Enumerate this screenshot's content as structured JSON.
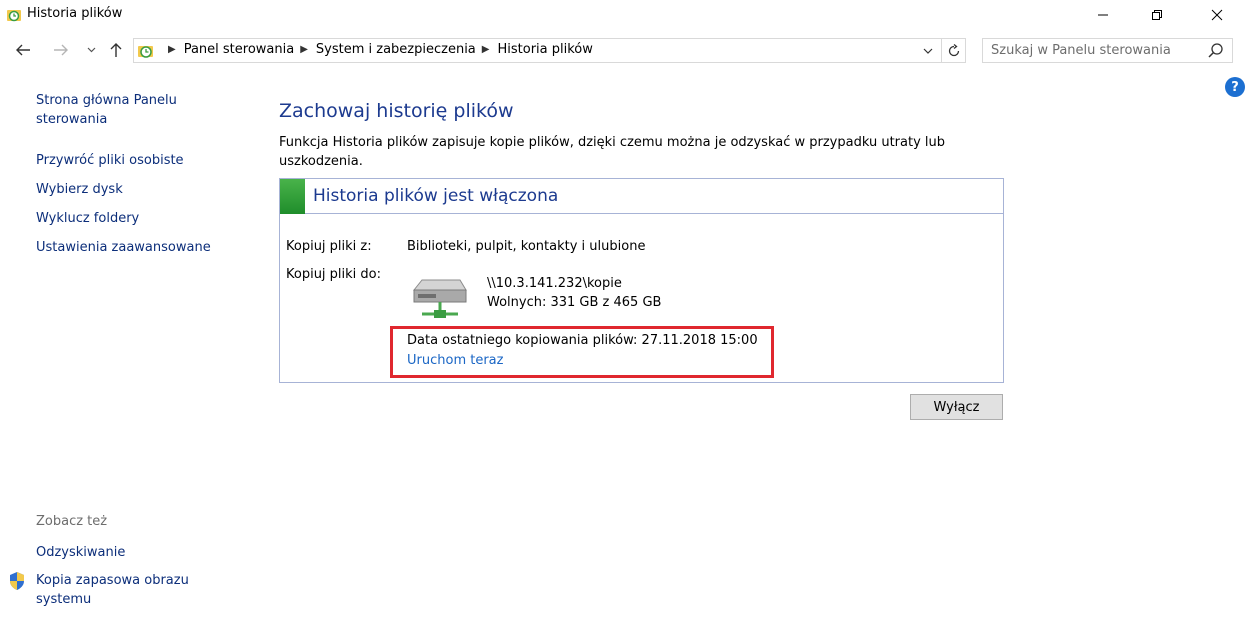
{
  "window": {
    "title": "Historia plików"
  },
  "address_bar": {
    "breadcrumbs": [
      "Panel sterowania",
      "System i zabezpieczenia",
      "Historia plików"
    ]
  },
  "search": {
    "placeholder": "Szukaj w Panelu sterowania"
  },
  "help": {
    "label": "?"
  },
  "sidebar": {
    "links": [
      "Strona główna Panelu sterowania",
      "Przywróć pliki osobiste",
      "Wybierz dysk",
      "Wyklucz foldery",
      "Ustawienia zaawansowane"
    ],
    "see_also_title": "Zobacz też",
    "see_also_links": [
      "Odzyskiwanie",
      "Kopia zapasowa obrazu systemu"
    ]
  },
  "main": {
    "heading": "Zachowaj historię plików",
    "description": "Funkcja Historia plików zapisuje kopie plików, dzięki czemu można je odzyskać w przypadku utraty lub uszkodzenia.",
    "status": {
      "title": "Historia plików jest włączona",
      "copy_from_label": "Kopiuj pliki z:",
      "copy_from_value": "Biblioteki, pulpit, kontakty i ulubione",
      "copy_to_label": "Kopiuj pliki do:",
      "drive_path": "\\\\10.3.141.232\\kopie",
      "drive_free": "Wolnych: 331 GB z 465 GB",
      "last_backup": "Data ostatniego kopiowania plików: 27.11.2018 15:00",
      "run_now": "Uruchom teraz"
    },
    "disable_button": "Wyłącz"
  },
  "colors": {
    "accent_link": "#1a66c5",
    "heading": "#1c3a8f",
    "status_green": "#2f9e3a",
    "highlight_box": "#e0282f"
  }
}
